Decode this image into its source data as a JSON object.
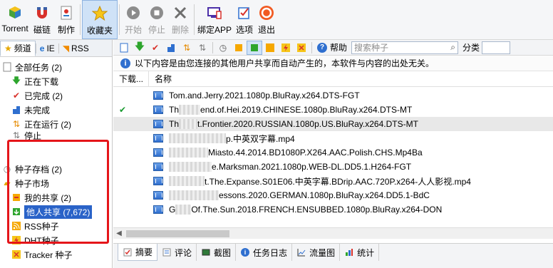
{
  "toolbar": {
    "items": [
      {
        "label": "Torrent",
        "icon": "torrent-icon"
      },
      {
        "label": "磁链",
        "icon": "magnet-icon"
      },
      {
        "label": "制作",
        "icon": "make-torrent-icon"
      },
      {
        "label": "收藏夹",
        "icon": "star-icon"
      },
      {
        "label": "开始",
        "icon": "start-icon"
      },
      {
        "label": "停止",
        "icon": "stop-icon"
      },
      {
        "label": "删除",
        "icon": "delete-icon"
      },
      {
        "label": "绑定APP",
        "icon": "bind-app-icon"
      },
      {
        "label": "选项",
        "icon": "options-icon"
      },
      {
        "label": "退出",
        "icon": "exit-icon"
      }
    ]
  },
  "left_tabs": [
    {
      "label": "频道",
      "icon": "star-icon"
    },
    {
      "label": "IE",
      "icon": "ie-icon"
    },
    {
      "label": "RSS",
      "icon": "rss-icon"
    }
  ],
  "tree": [
    {
      "label": "全部任务 (2)",
      "icon": "all-tasks-icon"
    },
    {
      "label": "正在下载",
      "icon": "download-icon"
    },
    {
      "label": "已完成 (2)",
      "icon": "check-icon"
    },
    {
      "label": "未完成",
      "icon": "incomplete-icon"
    },
    {
      "label": "正在运行 (2)",
      "icon": "running-icon"
    },
    {
      "label": "停止",
      "icon": "stop-icon"
    },
    {
      "label": "种子存档 (2)",
      "icon": "archive-icon"
    },
    {
      "label": "种子市场",
      "icon": "market-icon"
    },
    {
      "label": "我的共享 (2)",
      "icon": "my-share-icon"
    },
    {
      "label": "他人共享 (7,672)",
      "icon": "others-share-icon"
    },
    {
      "label": "RSS种子",
      "icon": "rss-icon"
    },
    {
      "label": "DHT种子",
      "icon": "dht-icon"
    },
    {
      "label": "Tracker 种子",
      "icon": "tracker-icon"
    }
  ],
  "right_toolbar": {
    "help_label": "帮助",
    "search_placeholder": "搜索种子",
    "category_label": "分类"
  },
  "info_text": "以下内容是由您连接的其他用户共享而自动产生的，本软件与内容的出处无关。",
  "table": {
    "headers": [
      "下载...",
      "名称"
    ],
    "rows": [
      {
        "checked": false,
        "prefix": "",
        "name": "Tom.and.Jerry.2021.1080p.BluRay.x264.DTS-FGT"
      },
      {
        "checked": true,
        "prefix": "Th",
        "name": "end.of.Hei.2019.CHINESE.1080p.BluRay.x264.DTS-MT"
      },
      {
        "checked": false,
        "prefix": "Th",
        "name": "t.Frontier.2020.RUSSIAN.1080p.US.BluRay.x264.DTS-MT"
      },
      {
        "checked": false,
        "prefix": "",
        "name": "p.中英双字幕.mp4"
      },
      {
        "checked": false,
        "prefix": "",
        "name": "Miasto.44.2014.BD1080P.X264.AAC.Polish.CHS.Mp4Ba"
      },
      {
        "checked": false,
        "prefix": "",
        "name": "e.Marksman.2021.1080p.WEB-DL.DD5.1.H264-FGT"
      },
      {
        "checked": false,
        "prefix": "",
        "name": "t.The.Expanse.S01E06.中英字幕.BDrip.AAC.720P.x264-人人影视.mp4"
      },
      {
        "checked": false,
        "prefix": "",
        "name": "essons.2020.GERMAN.1080p.BluRay.x264.DD5.1-BdC"
      },
      {
        "checked": false,
        "prefix": "G",
        "name": "Of.The.Sun.2018.FRENCH.ENSUBBED.1080p.BluRay.x264-DON"
      }
    ]
  },
  "bottom_tabs": [
    {
      "label": "摘要",
      "icon": "summary-icon"
    },
    {
      "label": "评论",
      "icon": "comment-icon"
    },
    {
      "label": "截图",
      "icon": "screenshot-icon"
    },
    {
      "label": "任务日志",
      "icon": "log-icon"
    },
    {
      "label": "流量图",
      "icon": "traffic-chart-icon"
    },
    {
      "label": "统计",
      "icon": "stats-icon"
    }
  ],
  "colors": {
    "accent": "#2a63c8",
    "highlight_box": "#e5151a",
    "check": "#189a2f"
  }
}
